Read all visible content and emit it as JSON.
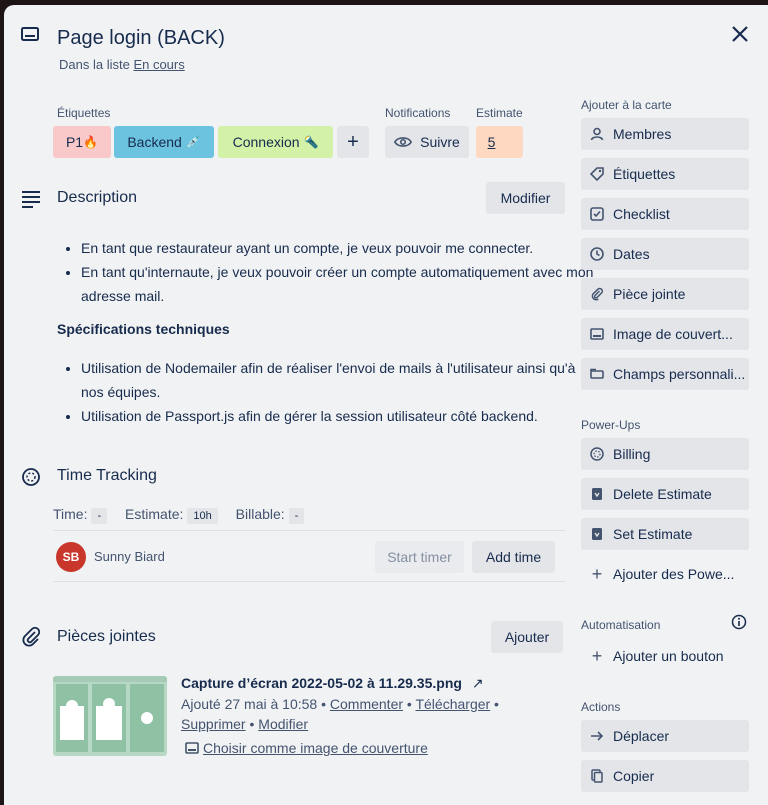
{
  "card": {
    "title": "Page login (BACK)",
    "list_prefix": "Dans la liste",
    "list_name": "En cours"
  },
  "labels": {
    "heading": "Étiquettes",
    "items": [
      {
        "text": "P1",
        "emoji": "🔥",
        "color": "#f9c9c9"
      },
      {
        "text": "Backend",
        "emoji": "💉",
        "color": "#6cc3e0"
      },
      {
        "text": "Connexion",
        "emoji": "🔦",
        "color": "#d3f1a7"
      }
    ],
    "add": "+"
  },
  "notifications": {
    "heading": "Notifications",
    "button": "Suivre"
  },
  "estimate": {
    "heading": "Estimate",
    "value": "5"
  },
  "description": {
    "title": "Description",
    "edit": "Modifier",
    "bullets1": [
      "En tant que restaurateur ayant un compte, je veux pouvoir me connecter.",
      "En tant qu'internaute, je veux pouvoir créer un compte automatiquement avec mon adresse mail."
    ],
    "spec_heading": "Spécifications techniques",
    "bullets2": [
      "Utilisation de Nodemailer afin de réaliser l'envoi de mails à l'utilisateur ainsi qu'à nos équipes.",
      "Utilisation de Passport.js afin de gérer la session utilisateur côté backend."
    ]
  },
  "time_tracking": {
    "title": "Time Tracking",
    "time_label": "Time:",
    "time_value": "-",
    "estimate_label": "Estimate:",
    "estimate_value": "10h",
    "billable_label": "Billable:",
    "billable_value": "-",
    "user_initials": "SB",
    "user_name": "Sunny Biard",
    "start_timer": "Start timer",
    "add_time": "Add time"
  },
  "attachments": {
    "title": "Pièces jointes",
    "add": "Ajouter",
    "file_name": "Capture d’écran 2022-05-02 à 11.29.35.png",
    "added": "Ajouté 27 mai à 10:58 •",
    "comment": "Commenter",
    "download": "Télécharger",
    "delete": "Supprimer",
    "modify": "Modifier",
    "cover": "Choisir comme image de couverture"
  },
  "sidebar": {
    "add_heading": "Ajouter à la carte",
    "add_items": [
      "Membres",
      "Étiquettes",
      "Checklist",
      "Dates",
      "Pièce jointe",
      "Image de couvert...",
      "Champs personnali..."
    ],
    "powerups_heading": "Power-Ups",
    "powerups": [
      "Billing",
      "Delete Estimate",
      "Set Estimate"
    ],
    "add_powerups": "Ajouter des Powe...",
    "automation_heading": "Automatisation",
    "add_button": "Ajouter un bouton",
    "actions_heading": "Actions",
    "actions": [
      "Déplacer",
      "Copier"
    ]
  }
}
